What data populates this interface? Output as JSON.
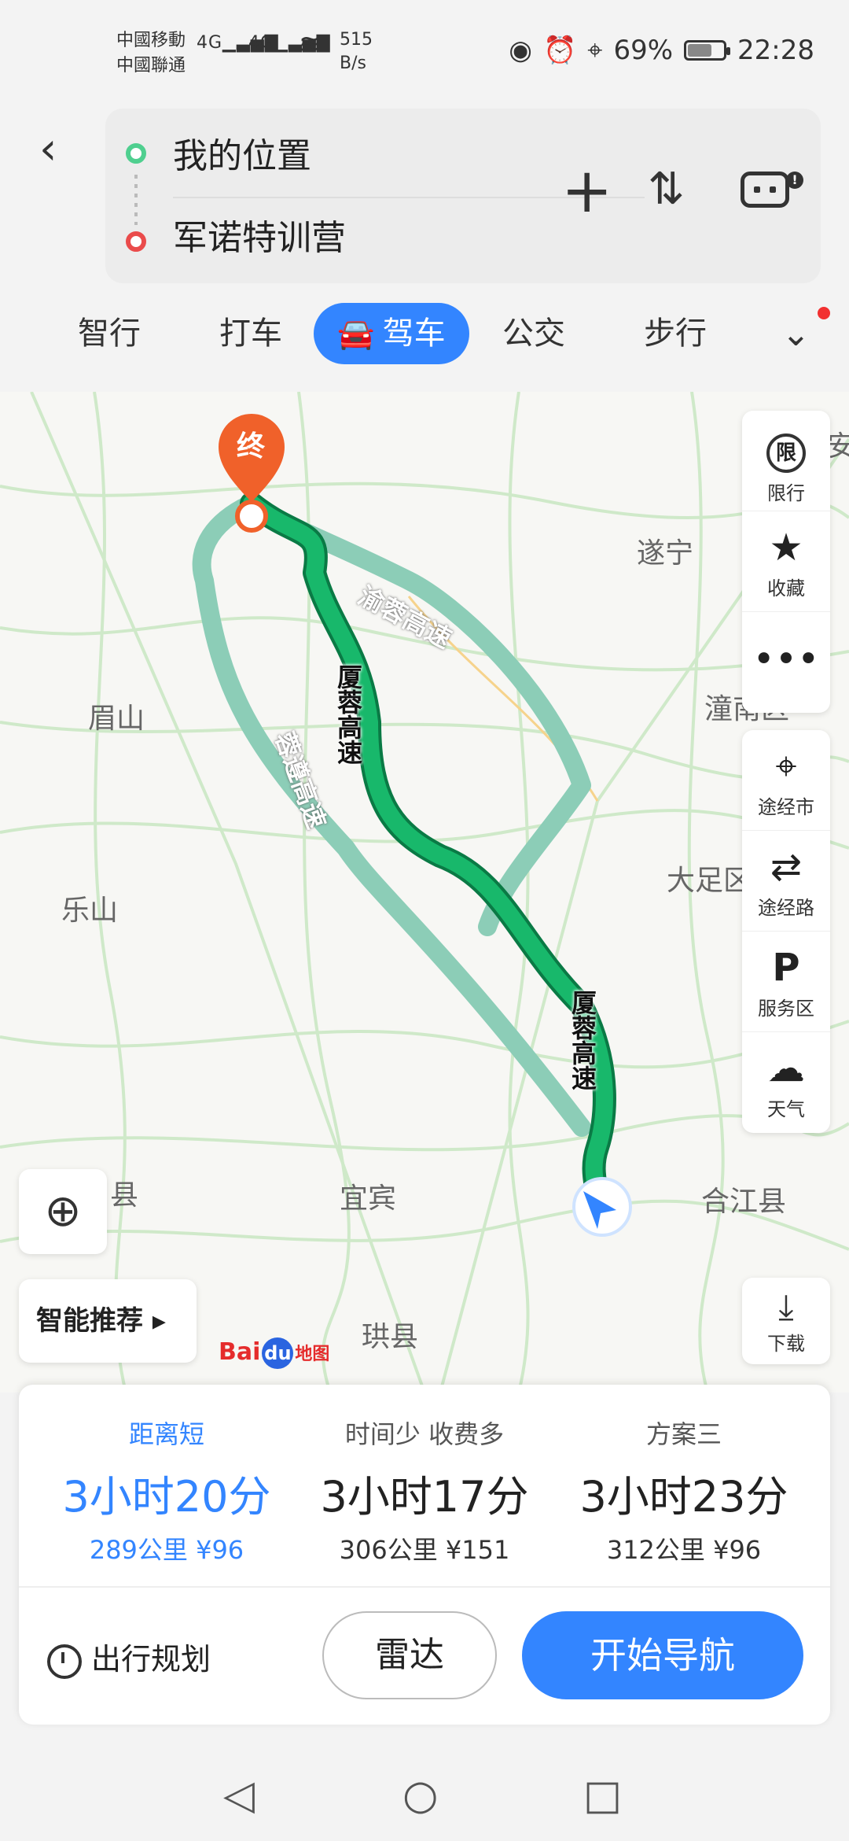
{
  "status_bar": {
    "carrier1": "中國移動",
    "carrier2": "中國聯通",
    "signal1": "4G",
    "signal2": "4G",
    "net_speed_value": "515",
    "net_speed_unit": "B/s",
    "battery": "69%",
    "battery_level": 0.69,
    "time": "22:28"
  },
  "route_input": {
    "origin": "我的位置",
    "destination": "军诺特训营"
  },
  "mode_tabs": [
    {
      "label": "智行"
    },
    {
      "label": "打车"
    },
    {
      "label": "驾车",
      "active": true
    },
    {
      "label": "公交"
    },
    {
      "label": "步行"
    }
  ],
  "map": {
    "end_marker": "终",
    "cities": {
      "suining": "遂宁",
      "meishan": "眉山",
      "leshan": "乐山",
      "dazu": "大足区",
      "tongnan": "潼南区",
      "yibin": "宜宾",
      "hejiang": "合江县",
      "gongxian": "珙县",
      "county_left": "县",
      "edge_top_right": "安"
    },
    "roads": {
      "main1": "厦蓉高速",
      "main2": "厦蓉高速",
      "alt_top": "渝蓉高速",
      "alt_left": "蓉遵高速"
    },
    "logo": {
      "bai": "Bai",
      "du": "du",
      "ditu": "地图"
    }
  },
  "tools": [
    {
      "icon": "限",
      "label": "限行"
    },
    {
      "icon": "★",
      "label": "收藏"
    },
    {
      "icon": "•••",
      "label": ""
    },
    {
      "icon": "⌖",
      "label": "途经市"
    },
    {
      "icon": "⇄",
      "label": "途经路"
    },
    {
      "icon": "P",
      "label": "服务区"
    },
    {
      "icon": "☁",
      "label": "天气"
    }
  ],
  "smart_recommend": "智能推荐 ▸",
  "download": {
    "label": "下载"
  },
  "plans": [
    {
      "tag": "距离短",
      "time": "3小时20分",
      "info": "289公里  ¥96",
      "selected": true
    },
    {
      "tag": "时间少  收费多",
      "time": "3小时17分",
      "info": "306公里  ¥151"
    },
    {
      "tag": "方案三",
      "time": "3小时23分",
      "info": "312公里  ¥96"
    }
  ],
  "actions": {
    "schedule": "出行规划",
    "radar": "雷达",
    "start_nav": "开始导航"
  },
  "colors": {
    "accent": "#3385ff",
    "route_main": "#18b86b",
    "route_alt": "#8ccdb7",
    "end_marker": "#f0612a"
  }
}
